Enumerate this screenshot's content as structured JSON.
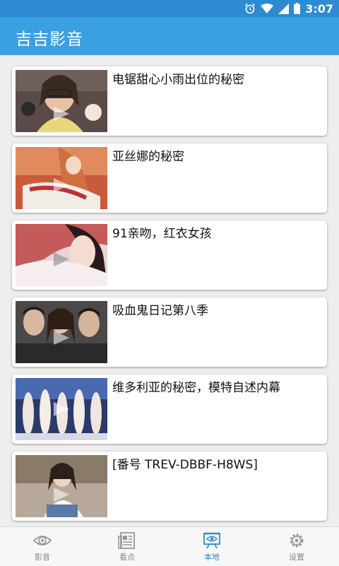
{
  "status_bar": {
    "time": "3:07",
    "icons": [
      "alarm-icon",
      "wifi-icon",
      "signal-icon",
      "battery-icon"
    ]
  },
  "app_bar": {
    "title": "吉吉影音"
  },
  "videos": [
    {
      "title": "电锯甜心小雨出位的秘密",
      "thumb": "video-thumbnail"
    },
    {
      "title": "亚丝娜的秘密",
      "thumb": "video-thumbnail"
    },
    {
      "title": "91亲吻，红衣女孩",
      "thumb": "video-thumbnail"
    },
    {
      "title": "吸血鬼日记第八季",
      "thumb": "video-thumbnail"
    },
    {
      "title": "维多利亚的秘密，模特自述内幕",
      "thumb": "video-thumbnail"
    },
    {
      "title": "[番号 TREV-DBBF-H8WS]",
      "thumb": "video-thumbnail"
    }
  ],
  "bottom_nav": {
    "items": [
      {
        "label": "影音",
        "icon": "eye-icon",
        "active": false
      },
      {
        "label": "看点",
        "icon": "newspaper-icon",
        "active": false
      },
      {
        "label": "本地",
        "icon": "local-screen-icon",
        "active": true
      },
      {
        "label": "设置",
        "icon": "gear-icon",
        "active": false
      }
    ]
  },
  "colors": {
    "status_bar": "#2c8bd2",
    "app_bar": "#3ba0e0",
    "accent": "#2c8bd2",
    "background": "#eeeeee"
  }
}
